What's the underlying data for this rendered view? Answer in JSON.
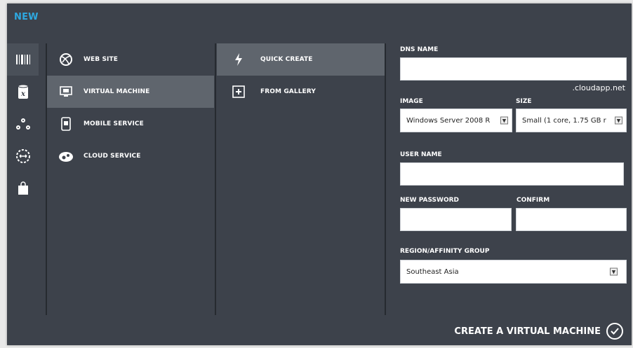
{
  "window": {
    "title": "NEW"
  },
  "rail": {
    "items": [
      {
        "icon": "barcode-icon",
        "active": true
      },
      {
        "icon": "x-storage-icon",
        "active": false
      },
      {
        "icon": "nodes-icon",
        "active": false
      },
      {
        "icon": "network-circle-icon",
        "active": false
      },
      {
        "icon": "shopping-bag-icon",
        "active": false
      }
    ]
  },
  "services": {
    "items": [
      {
        "label": "WEB SITE",
        "icon": "globe-icon",
        "selected": false
      },
      {
        "label": "VIRTUAL MACHINE",
        "icon": "monitor-icon",
        "selected": true
      },
      {
        "label": "MOBILE SERVICE",
        "icon": "phone-icon",
        "selected": false
      },
      {
        "label": "CLOUD SERVICE",
        "icon": "gears-icon",
        "selected": false
      }
    ]
  },
  "methods": {
    "items": [
      {
        "label": "QUICK CREATE",
        "icon": "lightning-icon",
        "selected": true
      },
      {
        "label": "FROM GALLERY",
        "icon": "plus-box-icon",
        "selected": false
      }
    ]
  },
  "form": {
    "dns_label": "DNS NAME",
    "dns_value": "",
    "dns_suffix": ".cloudapp.net",
    "image_label": "IMAGE",
    "image_value": "Windows Server 2008 R",
    "size_label": "SIZE",
    "size_value": "Small (1 core, 1.75 GB r",
    "user_label": "USER NAME",
    "user_value": "",
    "password_label": "NEW PASSWORD",
    "confirm_label": "CONFIRM",
    "region_label": "REGION/AFFINITY GROUP",
    "region_value": "Southeast Asia"
  },
  "footer": {
    "create_label": "CREATE A VIRTUAL MACHINE"
  }
}
